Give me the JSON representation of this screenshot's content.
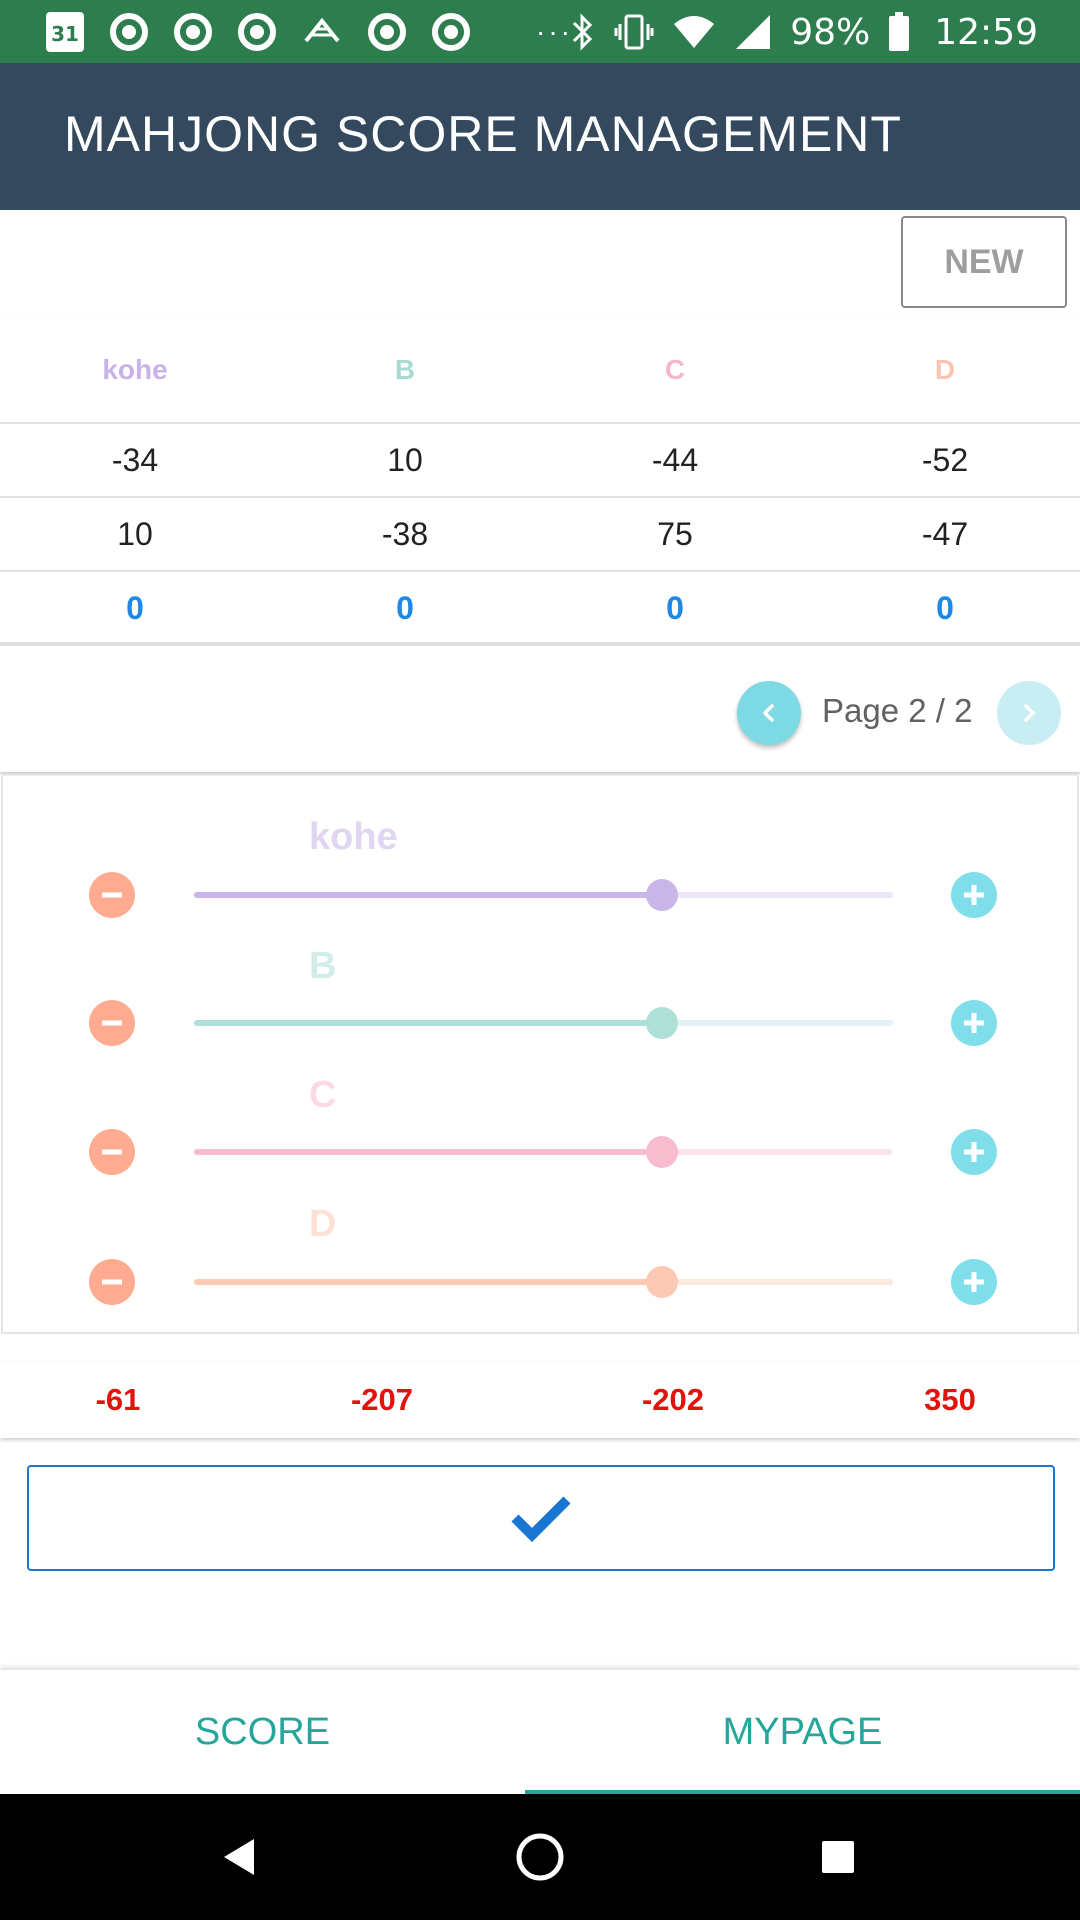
{
  "status_bar": {
    "calendar_day": "31",
    "overflow": "···",
    "battery": "98%",
    "time": "12:59"
  },
  "app": {
    "title": "MAHJONG SCORE MANAGEMENT",
    "new_button": "NEW"
  },
  "score_table": {
    "players": [
      {
        "name": "kohe",
        "color": "#c7b3e6"
      },
      {
        "name": "B",
        "color": "#a8dcd3"
      },
      {
        "name": "C",
        "color": "#f7b6ce"
      },
      {
        "name": "D",
        "color": "#fcc4b0"
      }
    ],
    "rows": [
      [
        "-34",
        "10",
        "-44",
        "-52"
      ],
      [
        "10",
        "-38",
        "75",
        "-47"
      ],
      [
        "0",
        "0",
        "0",
        "0"
      ]
    ]
  },
  "pagination": {
    "label": "Page 2 / 2",
    "current": 2,
    "total": 2
  },
  "sliders": [
    {
      "name": "kohe",
      "color": "#c9b6e8",
      "track_light": "#ece6f6",
      "value_fraction": 0.669
    },
    {
      "name": "B",
      "color": "#aee0d8",
      "track_light": "#e2f3f6",
      "value_fraction": 0.669
    },
    {
      "name": "C",
      "color": "#f8bccf",
      "track_light": "#fce3eb",
      "value_fraction": 0.669
    },
    {
      "name": "D",
      "color": "#fcc9b4",
      "track_light": "#fde8df",
      "value_fraction": 0.669
    }
  ],
  "totals": [
    "-61",
    "-207",
    "-202",
    "350"
  ],
  "tabs": {
    "score": "SCORE",
    "mypage": "MYPAGE",
    "active": "mypage"
  },
  "colors": {
    "status_bar": "#2e7d4f",
    "app_bar": "#34495e",
    "accent_teal": "#26a69a",
    "confirm_blue": "#1976d2",
    "total_red": "#e3120b",
    "zero_blue": "#1e88e5",
    "minus": "#ffab91",
    "plus": "#80deea"
  }
}
